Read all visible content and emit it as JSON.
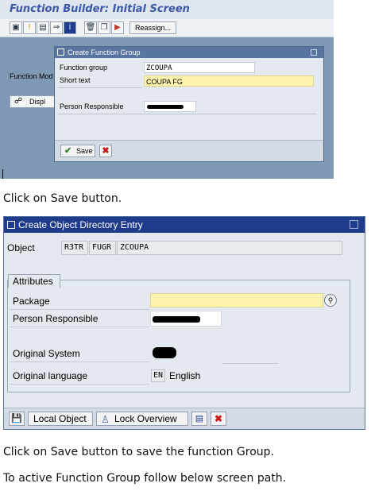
{
  "function_builder": {
    "title": "Function Builder: Initial Screen",
    "reassign_label": "Reassign...",
    "function_module_label": "Function Mod",
    "display_label": "Displ"
  },
  "create_function_group": {
    "title": "Create Function Group",
    "function_group_label": "Function group",
    "function_group_value": "ZCOUPA",
    "short_text_label": "Short text",
    "short_text_value": "COUPA FG",
    "person_responsible_label": "Person Responsible",
    "save_label": "Save"
  },
  "captions": {
    "step1": "Click on Save button.",
    "step2": "Click on Save button to save the function Group.",
    "step3": "To active Function Group follow below screen path."
  },
  "object_directory": {
    "title": "Create Object Directory Entry",
    "object_label": "Object",
    "object_values": [
      "R3TR",
      "FUGR",
      "ZCOUPA"
    ],
    "attributes_tab": "Attributes",
    "package_label": "Package",
    "package_value": "",
    "person_responsible_label": "Person Responsible",
    "original_system_label": "Original System",
    "original_language_label": "Original language",
    "language_code": "EN",
    "language_name": "English",
    "local_object_label": "Local Object",
    "lock_overview_label": "Lock Overview"
  },
  "colors": {
    "dialog_title_bar": "#1f3c8c",
    "required_field": "#fff3b0",
    "sap_background": "#7f98b3"
  }
}
